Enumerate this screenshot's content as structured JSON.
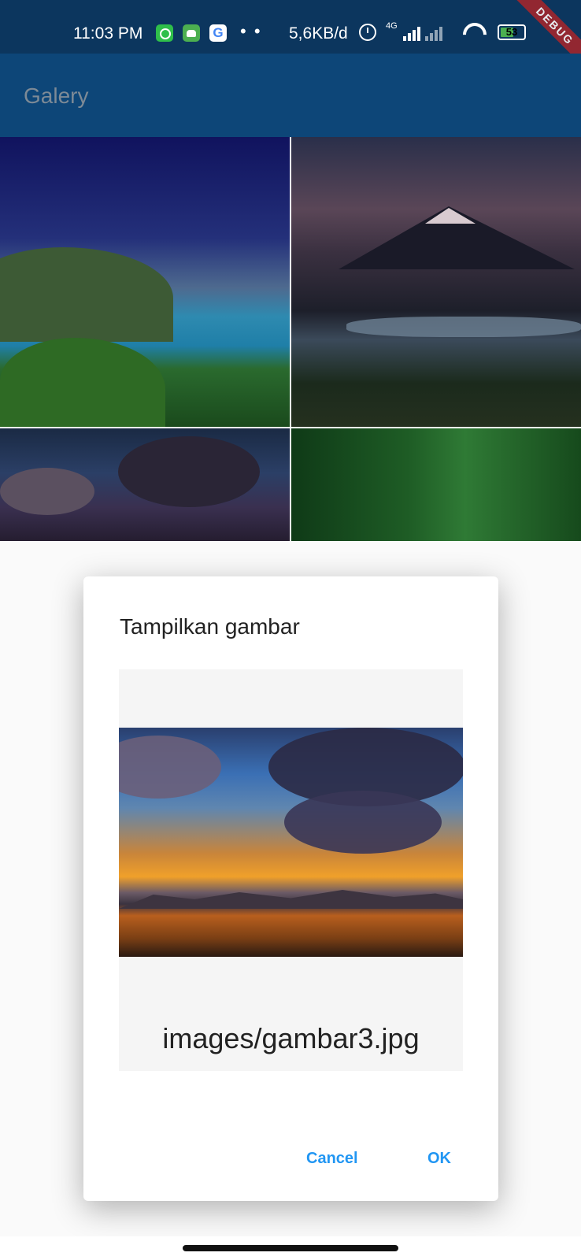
{
  "status_bar": {
    "time": "11:03 PM",
    "notifications": [
      "whatsapp-icon",
      "android-bot-icon",
      "google-icon"
    ],
    "more_dots": "• •",
    "net_speed": "5,6KB/d",
    "network_label": "4G",
    "battery_level": "53",
    "battery_color": "#4caf50",
    "google_glyph": "G"
  },
  "debug_banner": "DEBUG",
  "app_bar": {
    "title": "Galery"
  },
  "gallery": {
    "images": [
      "gambar1",
      "gambar2",
      "gambar3",
      "gambar4"
    ]
  },
  "dialog": {
    "title": "Tampilkan gambar",
    "filename": "images/gambar3.jpg",
    "cancel_label": "Cancel",
    "ok_label": "OK",
    "button_color": "#2196f3"
  },
  "colors": {
    "status_bar": "#0c365e",
    "app_bar": "#0d4678",
    "background": "#fafafa"
  }
}
